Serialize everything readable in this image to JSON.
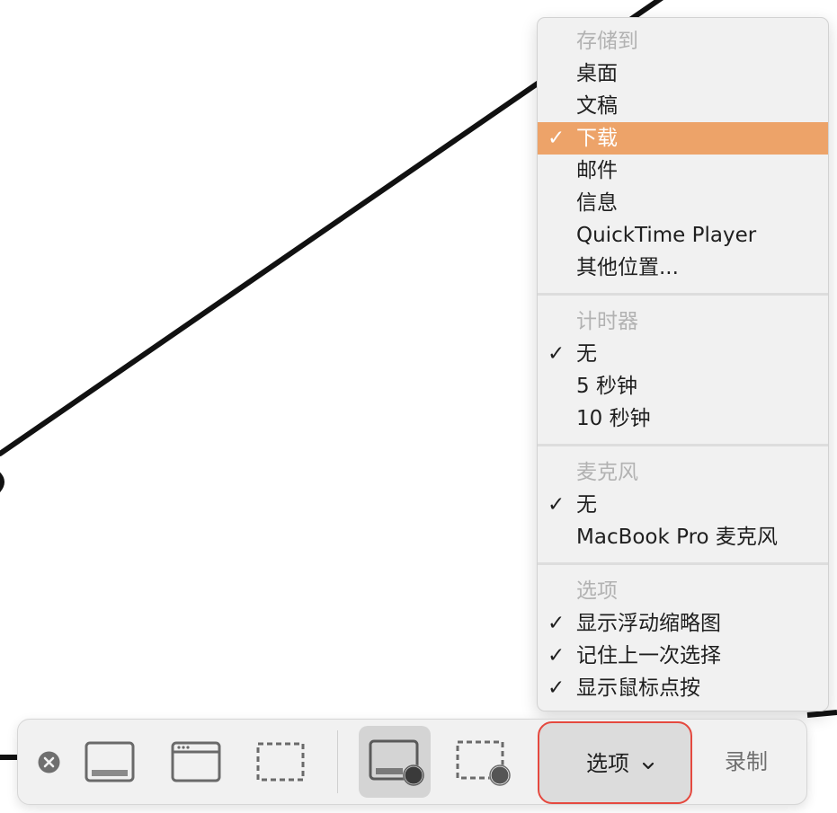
{
  "menu": {
    "save_to": {
      "header": "存储到",
      "items": [
        {
          "label": "桌面",
          "checked": false,
          "highlighted": false
        },
        {
          "label": "文稿",
          "checked": false,
          "highlighted": false
        },
        {
          "label": "下载",
          "checked": true,
          "highlighted": true
        },
        {
          "label": "邮件",
          "checked": false,
          "highlighted": false
        },
        {
          "label": "信息",
          "checked": false,
          "highlighted": false
        },
        {
          "label": "QuickTime Player",
          "checked": false,
          "highlighted": false
        },
        {
          "label": "其他位置...",
          "checked": false,
          "highlighted": false
        }
      ]
    },
    "timer": {
      "header": "计时器",
      "items": [
        {
          "label": "无",
          "checked": true
        },
        {
          "label": "5 秒钟",
          "checked": false
        },
        {
          "label": "10 秒钟",
          "checked": false
        }
      ]
    },
    "microphone": {
      "header": "麦克风",
      "items": [
        {
          "label": "无",
          "checked": true
        },
        {
          "label": "MacBook Pro 麦克风",
          "checked": false
        }
      ]
    },
    "options": {
      "header": "选项",
      "items": [
        {
          "label": "显示浮动缩略图",
          "checked": true
        },
        {
          "label": "记住上一次选择",
          "checked": true
        },
        {
          "label": "显示鼠标点按",
          "checked": true
        }
      ]
    },
    "check_mark": "✓"
  },
  "toolbar": {
    "options_label": "选项",
    "record_label": "录制",
    "icons": [
      "close-icon",
      "capture-entire-screen-icon",
      "capture-window-icon",
      "capture-selection-icon",
      "record-entire-screen-icon",
      "record-selection-icon"
    ]
  },
  "colors": {
    "highlight": "#eda369",
    "options_outline": "#e5493f",
    "menu_bg": "#f1f1f1",
    "header_text": "#b2b2b2"
  }
}
